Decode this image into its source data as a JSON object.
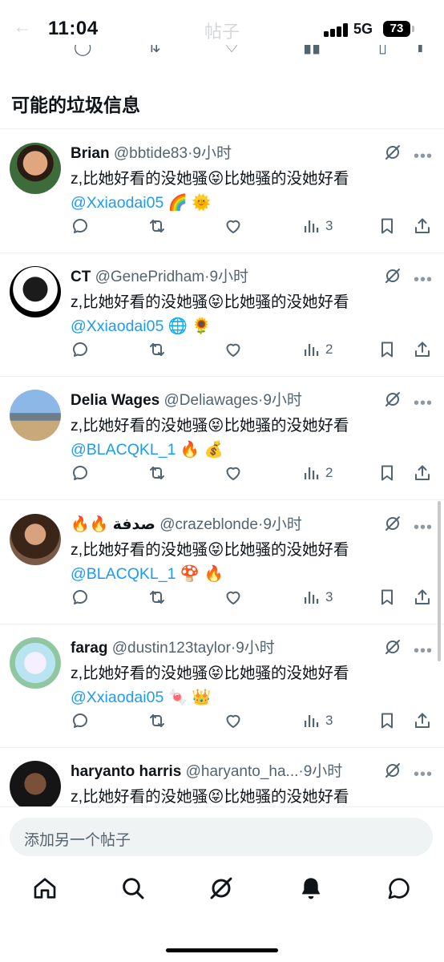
{
  "status_bar": {
    "time": "11:04",
    "network": "5G",
    "battery": "73",
    "faded_title": "帖子"
  },
  "section": {
    "title": "可能的垃圾信息"
  },
  "tweets": [
    {
      "name": "Brian",
      "handle": "@bbtide83",
      "time": "9小时",
      "text": "z,比她好看的没她骚😝比她骚的没她好看",
      "mention": "@Xxiaodai05",
      "emojis": "🌈 🌞",
      "views": "3"
    },
    {
      "name": "CT",
      "handle": "@GenePridham",
      "time": "9小时",
      "text": "z,比她好看的没她骚😝比她骚的没她好看",
      "mention": "@Xxiaodai05",
      "emojis": "🌐 🌻",
      "views": "2"
    },
    {
      "name": "Delia Wages",
      "handle": "@Deliawages",
      "time": "9小时",
      "text": "z,比她好看的没她骚😝比她骚的没她好看",
      "mention": "@BLACQKL_1",
      "emojis": "🔥 💰",
      "views": "2"
    },
    {
      "name": "🔥🔥 صدفة",
      "handle": "@crazeblonde",
      "time": "9小时",
      "text": "z,比她好看的没她骚😝比她骚的没她好看",
      "mention": "@BLACQKL_1",
      "emojis": "🍄 🔥",
      "views": "3"
    },
    {
      "name": "farag",
      "handle": "@dustin123taylor",
      "time": "9小时",
      "text": "z,比她好看的没她骚😝比她骚的没她好看",
      "mention": "@Xxiaodai05",
      "emojis": "🍬 👑",
      "views": "3"
    },
    {
      "name": "haryanto harris",
      "handle": "@haryanto_ha...",
      "time": "9小时",
      "text": "z,比她好看的没她骚😝比她骚的没她好看",
      "mention": "",
      "emojis": "",
      "views": ""
    }
  ],
  "composer": {
    "placeholder": "添加另一个帖子"
  },
  "tabs": [
    "home-icon",
    "search-icon",
    "grok-icon",
    "notifications-icon",
    "messages-icon"
  ],
  "colors": {
    "accent": "#1d9bf0",
    "text": "#0f1419",
    "muted": "#536471"
  }
}
